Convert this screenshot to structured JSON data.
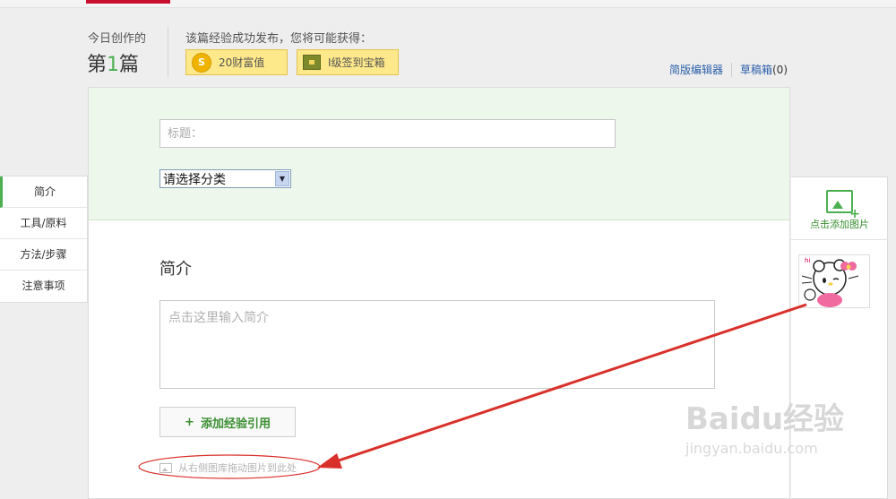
{
  "header": {
    "today_label": "今日创作的",
    "count_prefix": "第",
    "count_value": "1",
    "count_suffix": "篇",
    "reward_label": "该篇经验成功发布，您将可能获得：",
    "rewards": [
      {
        "icon": "coin-icon",
        "label": "20财富值"
      },
      {
        "icon": "treasure-chest-icon",
        "label": "I级签到宝箱"
      }
    ],
    "links": {
      "simple_editor": "简版编辑器",
      "drafts_label": "草稿箱",
      "drafts_count": "(0)"
    }
  },
  "form": {
    "title_placeholder": "标题：",
    "title_value": "",
    "category_selected": "请选择分类"
  },
  "section": {
    "heading": "简介",
    "intro_placeholder": "点击这里输入简介",
    "add_reference": "添加经验引用",
    "drag_hint": "从右侧图库拖动图片到此处"
  },
  "left_nav": {
    "items": [
      {
        "label": "简介",
        "active": true
      },
      {
        "label": "工具/原料",
        "active": false
      },
      {
        "label": "方法/步骤",
        "active": false
      },
      {
        "label": "注意事项",
        "active": false
      }
    ]
  },
  "right_panel": {
    "add_picture": "点击添加图片"
  },
  "watermark": {
    "brand": "Baidu经验",
    "url": "jingyan.baidu.com"
  },
  "colors": {
    "accent_green": "#4caf50",
    "link_blue": "#2b5ea8",
    "annotation_red": "#d9302a",
    "badge_yellow": "#fde88a"
  }
}
